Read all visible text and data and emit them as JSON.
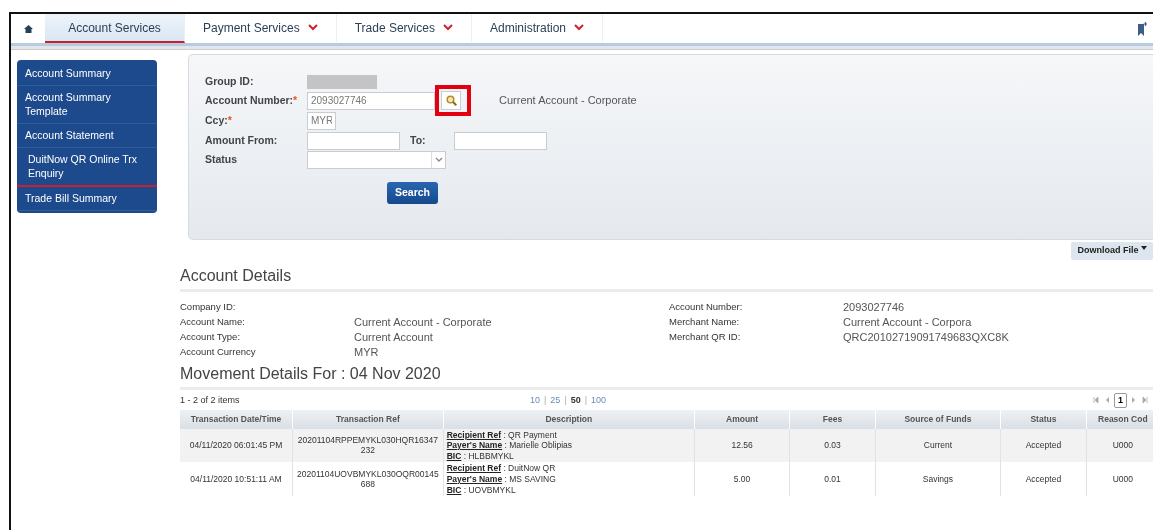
{
  "nav": {
    "tabs": [
      {
        "label": "Account Services",
        "selected": true,
        "dropdown": false
      },
      {
        "label": "Payment Services",
        "selected": false,
        "dropdown": true
      },
      {
        "label": "Trade Services",
        "selected": false,
        "dropdown": true
      },
      {
        "label": "Administration",
        "selected": false,
        "dropdown": true
      }
    ]
  },
  "sidebar": {
    "items": [
      {
        "label": "Account Summary",
        "selected": false
      },
      {
        "label": "Account Summary Template",
        "selected": false
      },
      {
        "label": "Account Statement",
        "selected": false
      },
      {
        "label": "DuitNow QR Online Trx Enquiry",
        "selected": true
      },
      {
        "label": "Trade Bill Summary",
        "selected": false
      }
    ]
  },
  "search_form": {
    "group_id": {
      "label": "Group ID:",
      "redacted": true
    },
    "account_number": {
      "label": "Account Number:",
      "required_mark": "*",
      "value": "2093027746",
      "description": "Current Account - Corporate",
      "lookup_highlighted": true
    },
    "ccy": {
      "label": "Ccy:",
      "required_mark": "*",
      "value": "MYR"
    },
    "amount_from": {
      "label": "Amount From:"
    },
    "amount_to": {
      "label": "To:"
    },
    "status": {
      "label": "Status"
    },
    "search_button": "Search"
  },
  "download_button": "Download File",
  "account_details": {
    "title": "Account Details",
    "left": [
      {
        "label": "Company ID:"
      },
      {
        "label": "Account Name:",
        "value": "Current Account - Corporate"
      },
      {
        "label": "Account Type:",
        "value": "Current Account"
      },
      {
        "label": "Account Currency",
        "value": "MYR"
      }
    ],
    "right": [
      {
        "label": "Account Number:",
        "value": "2093027746"
      },
      {
        "label": "Merchant Name:",
        "value": "Current Account - Corpora"
      },
      {
        "label": "Merchant QR ID:",
        "value": "QRC20102719091749683QXC8K"
      }
    ]
  },
  "movement": {
    "title": "Movement Details For : 04 Nov 2020",
    "items_count": "1 - 2 of 2 items",
    "page_sizes": [
      {
        "label": "10",
        "selected": false
      },
      {
        "separator": "|",
        "label": "25",
        "selected": false
      },
      {
        "separator": "|",
        "label": "50",
        "selected": true
      },
      {
        "separator": "|",
        "label": "100",
        "selected": false
      }
    ],
    "current_page": "1",
    "columns": [
      "Transaction Date/Time",
      "Transaction Ref",
      "Description",
      "Amount",
      "Fees",
      "Source of Funds",
      "Status",
      "Reason Cod"
    ],
    "rows": [
      {
        "datetime": "04/11/2020 06:01:45 PM",
        "ref": "20201104RPPEMYKL030HQR16347232",
        "description": [
          {
            "label": "Recipient Ref",
            "value": " : QR Payment"
          },
          {
            "label": "Payer's Name",
            "value": " : Marielle Oblipias"
          },
          {
            "label": "BIC",
            "value": " : HLBBMYKL"
          }
        ],
        "amount": "12.56",
        "fees": "0.03",
        "source": "Current",
        "status": "Accepted",
        "reason": "U000"
      },
      {
        "datetime": "04/11/2020 10:51:11 AM",
        "ref": "20201104UOVBMYKL030OQR00145688",
        "description": [
          {
            "label": "Recipient Ref",
            "value": " : DuitNow QR"
          },
          {
            "label": "Payer's Name",
            "value": " : MS SAVING"
          },
          {
            "label": "BIC",
            "value": " : UOVBMYKL"
          }
        ],
        "amount": "5.00",
        "fees": "0.01",
        "source": "Savings",
        "status": "Accepted",
        "reason": "U000"
      }
    ]
  }
}
